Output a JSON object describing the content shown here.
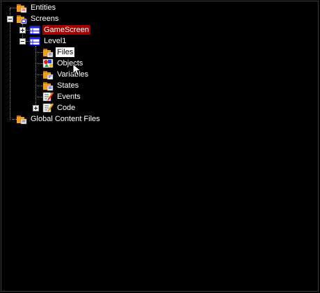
{
  "tree": {
    "entities_label": "Entities",
    "screens_label": "Screens",
    "gamescreen_label": "GameScreen",
    "level1_label": "Level1",
    "files_label": "Files",
    "objects_label": "Objects",
    "variables_label": "Variables",
    "states_label": "States",
    "events_label": "Events",
    "code_label": "Code",
    "global_content_label": "Global Content Files"
  },
  "colors": {
    "background": "#000000",
    "selection_red": "#a00000",
    "selection_white": "#ffffff",
    "folder_orange": "#f0a020",
    "screen_blue": "#2020e0"
  }
}
